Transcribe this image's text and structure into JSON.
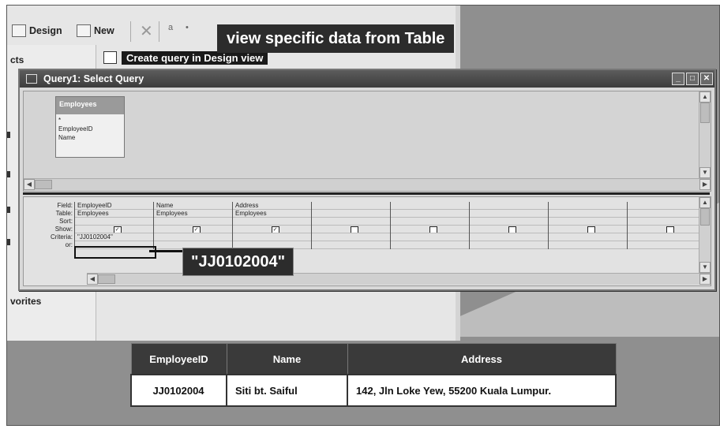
{
  "toolbar": {
    "design_label": "Design",
    "new_label": "New",
    "small_a": "a",
    "small_b": "•"
  },
  "left_pane": {
    "label_top": "cts",
    "label_bottom": "vorites"
  },
  "create_row": {
    "text": "Create query in Design view"
  },
  "callouts": {
    "title": "view specific data from Table",
    "criteria": "\"JJ0102004\""
  },
  "query_window": {
    "title": "Query1: Select Query",
    "table_box": {
      "name": "Employees",
      "fields": [
        "*",
        "EmployeeID",
        "Name"
      ]
    },
    "row_labels": [
      "Field:",
      "Table:",
      "Sort:",
      "Show:",
      "Criteria:",
      "or:"
    ],
    "columns": [
      {
        "field": "EmployeeID",
        "table": "Employees",
        "show": true,
        "criteria": "\"JJ0102004\""
      },
      {
        "field": "Name",
        "table": "Employees",
        "show": true,
        "criteria": ""
      },
      {
        "field": "Address",
        "table": "Employees",
        "show": true,
        "criteria": ""
      },
      {
        "field": "",
        "table": "",
        "show": false,
        "criteria": ""
      },
      {
        "field": "",
        "table": "",
        "show": false,
        "criteria": ""
      },
      {
        "field": "",
        "table": "",
        "show": false,
        "criteria": ""
      },
      {
        "field": "",
        "table": "",
        "show": false,
        "criteria": ""
      },
      {
        "field": "",
        "table": "",
        "show": false,
        "criteria": ""
      }
    ]
  },
  "result_table": {
    "headers": [
      "EmployeeID",
      "Name",
      "Address"
    ],
    "rows": [
      [
        "JJ0102004",
        "Siti bt. Saiful",
        "142, Jln Loke Yew, 55200 Kuala Lumpur."
      ]
    ]
  }
}
